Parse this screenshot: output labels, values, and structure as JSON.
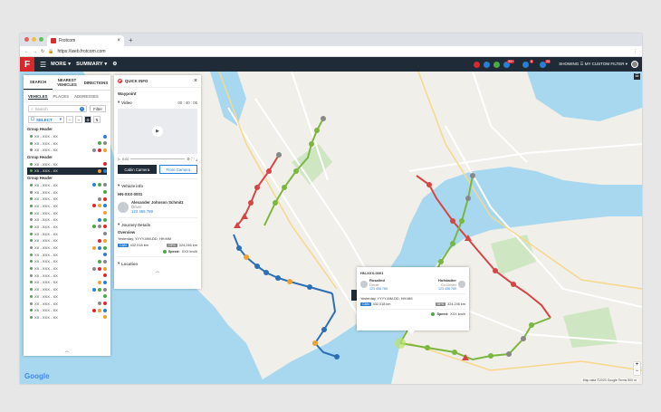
{
  "browser": {
    "tab_title": "Frotcom",
    "url": "https://web.frotcom.com"
  },
  "header": {
    "logo": "F",
    "more": "MORE ▾",
    "summary": "SUMMARY ▾",
    "badges": [
      "99+",
      "8",
      "26"
    ],
    "filter_label": "SHOWING ☰ MY CUSTOM FILTER ▾"
  },
  "left_panel": {
    "tabs": [
      "SEARCH",
      "NEAREST VEHICLES",
      "DIRECTIONS"
    ],
    "subtabs": [
      "VEHICLES",
      "PLACES",
      "ADDRESSES"
    ],
    "search_placeholder": "Search",
    "filter_btn": "Filter",
    "select_label": "SELECT",
    "groups": [
      {
        "header": "Group Header",
        "items": [
          "XX - XXX - XX",
          "XX - XXX - XX",
          "XX - XXX - XX"
        ]
      },
      {
        "header": "Group Header",
        "items": [
          "XX - XXX - XX",
          "XX - XXX - XX"
        ]
      },
      {
        "header": "Group Header",
        "items": [
          "XX - XXX - XX",
          "XX - XXX - XX",
          "XX - XXX - XX",
          "XX - XXX - XX",
          "XX - XXX - XX",
          "XX - XXX - XX",
          "XX - XXX - XX",
          "XX - XXX - XX",
          "XX - XXX - XX",
          "XX - XXX - XX",
          "XX - XXX - XX",
          "XX - XXX - XX",
          "XX - XXX - XX",
          "XX - XXX - XX",
          "XX - XXX - XX",
          "XX - XXX - XX",
          "XX - XXX - XX",
          "XX - XXX - XX",
          "XX - XXX - XX",
          "XX - XXX - XX"
        ]
      }
    ],
    "selected_index": 1
  },
  "quick_info": {
    "header": "QUICK INFO",
    "title": "Waypoint",
    "video_label": "Video",
    "video_time": "00 : 40 : 05",
    "video_pos": "0:00",
    "cabin_btn": "Cabin Camera",
    "front_btn": "Front Camera",
    "vehicle_info_label": "Vehicle info",
    "hn": "HN-XXX-0001",
    "driver_name": "Alexander Johnson Schmitz",
    "driver_role": "Driver",
    "driver_phone": "123 456 789",
    "journey_label": "Journey Details",
    "overview_label": "Overview",
    "overview_time": "Yesterday, YYYY-MM-DD, HH:MM",
    "can_label": "CAN",
    "can_value": "432,018 km",
    "gps_label": "GPS",
    "gps_value": "324,246 km",
    "speed_label": "Speed:",
    "speed_value": "XXX km/h",
    "location_label": "Location"
  },
  "popup": {
    "hn": "HN-XXX-0001",
    "driver1_name": "Rosalind",
    "driver1_role": "Driver",
    "driver1_phone": "123 456 789",
    "driver2_name": "Hofstadter",
    "driver2_role": "Co-Driver",
    "driver2_phone": "123 456 789",
    "time": "Yesterday, YYYY-MM-DD, HH:MM",
    "can_label": "CAN",
    "can_value": "432,018 km",
    "gps_label": "GPS",
    "gps_value": "324,246 km",
    "speed_label": "Speed:",
    "speed_value": "XXX km/h"
  },
  "map": {
    "google": "Google",
    "footer": "Map data ©2023 Google   Terms   500 m",
    "zoom_in": "+",
    "zoom_out": "−"
  },
  "colors": {
    "header_bg": "#1f2b36",
    "brand_red": "#d7292c",
    "accent_blue": "#2a7fd4",
    "route_green": "#7bb73f",
    "route_red": "#d64545",
    "route_blue": "#2c6fb5",
    "water": "#a7d8f0"
  }
}
